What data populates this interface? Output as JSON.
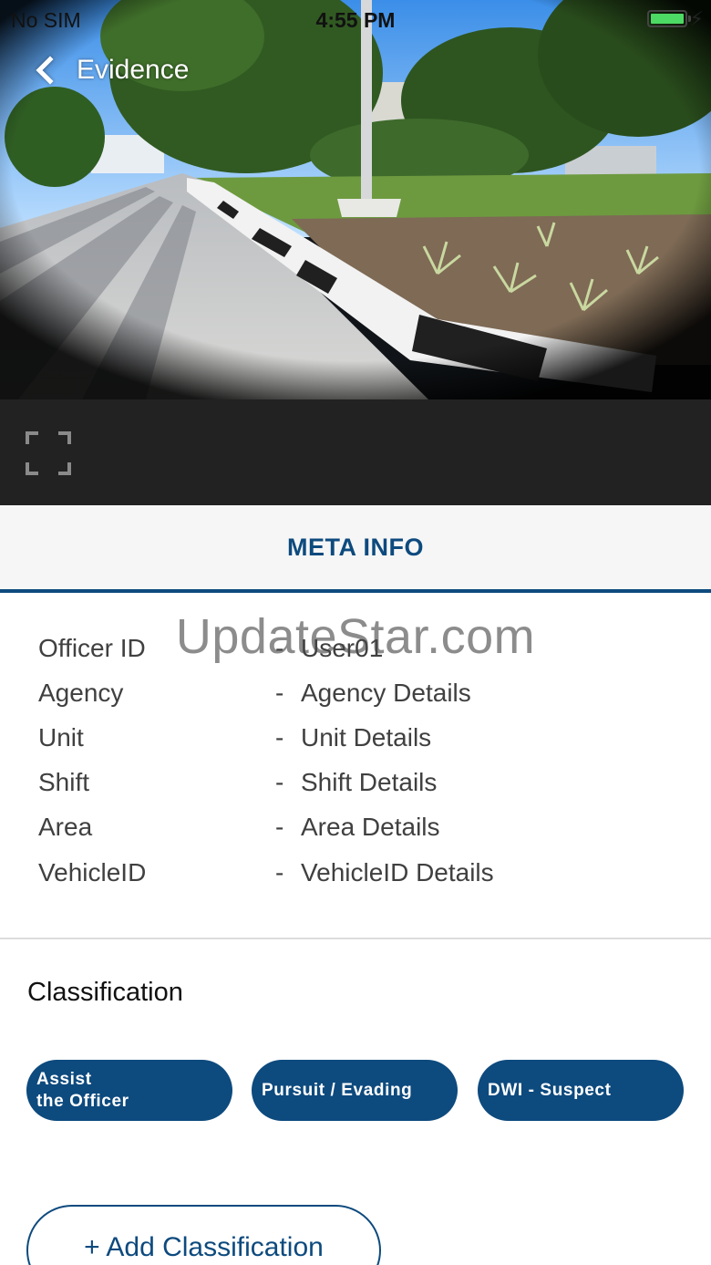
{
  "status_bar": {
    "carrier": "No SIM",
    "time": "4:55 PM",
    "battery_level": 1.0
  },
  "nav": {
    "title": "Evidence",
    "back_icon": "chevron-left-icon"
  },
  "player": {
    "fullscreen_icon": "fullscreen-icon"
  },
  "tab": {
    "label": "META INFO",
    "accent_color": "#0d4a7e"
  },
  "meta": {
    "separator": "-",
    "rows": [
      {
        "label": "Officer ID",
        "value": "User01"
      },
      {
        "label": "Agency",
        "value": "Agency Details"
      },
      {
        "label": "Unit",
        "value": "Unit Details"
      },
      {
        "label": "Shift",
        "value": "Shift Details"
      },
      {
        "label": "Area",
        "value": "Area Details"
      },
      {
        "label": "VehicleID",
        "value": "VehicleID Details"
      }
    ]
  },
  "watermark": "UpdateStar.com",
  "classification": {
    "title": "Classification",
    "chips": [
      {
        "line1": "Assist",
        "line2": "the Officer"
      },
      {
        "line1": "Pursuit / Evading",
        "line2": ""
      },
      {
        "line1": "DWI - Suspect",
        "line2": ""
      }
    ],
    "add_label": "+ Add Classification"
  }
}
